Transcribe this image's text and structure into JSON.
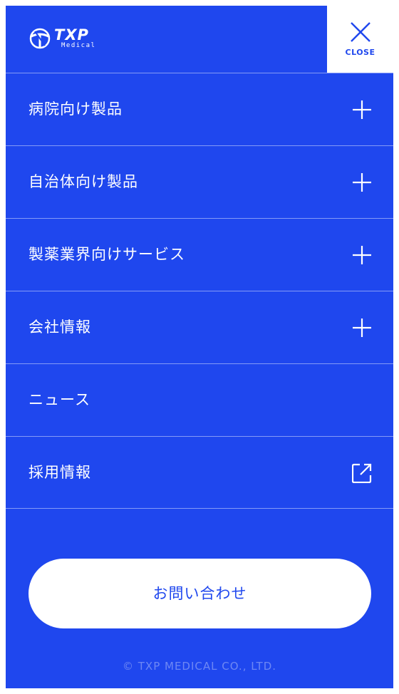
{
  "header": {
    "logo_text": "TXP",
    "logo_sub": "Medical",
    "close_label": "CLOSE"
  },
  "nav": {
    "items": [
      {
        "label": "病院向け製品",
        "icon": "plus-icon"
      },
      {
        "label": "自治体向け製品",
        "icon": "plus-icon"
      },
      {
        "label": "製薬業界向けサービス",
        "icon": "plus-icon"
      },
      {
        "label": "会社情報",
        "icon": "plus-icon"
      },
      {
        "label": "ニュース",
        "icon": ""
      },
      {
        "label": "採用情報",
        "icon": "external-link-icon"
      }
    ]
  },
  "contact": {
    "label": "お問い合わせ"
  },
  "footer": {
    "copyright": "© TXP MEDICAL CO., LTD."
  },
  "colors": {
    "brand": "#1f47ee",
    "text_on_brand": "#ffffff"
  }
}
